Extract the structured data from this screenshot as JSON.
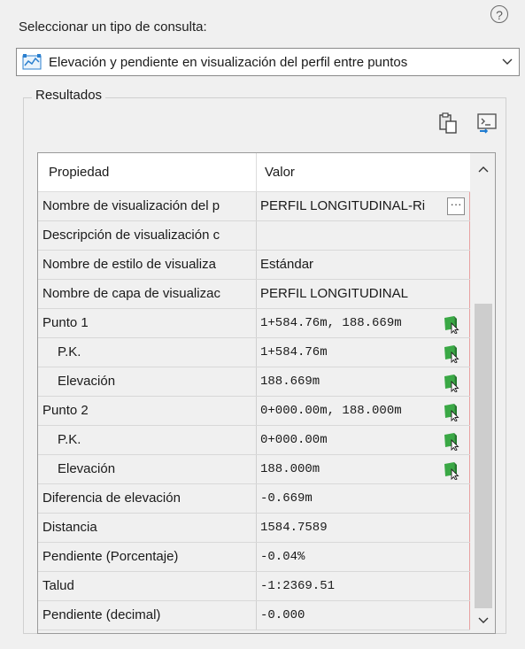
{
  "header": {
    "select_label": "Seleccionar un tipo de consulta:",
    "help_glyph": "?"
  },
  "query_type": {
    "selected": "Elevación y pendiente en visualización del perfil entre puntos",
    "icon": "profile-query-icon"
  },
  "results": {
    "title": "Resultados",
    "tools": [
      "copy-to-clipboard-icon",
      "command-line-icon"
    ],
    "columns": {
      "property": "Propiedad",
      "value": "Valor"
    },
    "rows": [
      {
        "property": "Nombre de visualización del p",
        "value": "PERFIL LONGITUDINAL-Ri",
        "indent": false,
        "control": "ellipsis",
        "ellipsis": "···"
      },
      {
        "property": "Descripción de visualización c",
        "value": "",
        "indent": false,
        "control": "none"
      },
      {
        "property": "Nombre de estilo de visualiza",
        "value": "Estándar",
        "indent": false,
        "control": "none"
      },
      {
        "property": "Nombre de capa de visualizac",
        "value": "PERFIL LONGITUDINAL",
        "indent": false,
        "control": "none"
      },
      {
        "property": "Punto 1",
        "value": "1+584.76m, 188.669m",
        "indent": false,
        "control": "pick"
      },
      {
        "property": "P.K.",
        "value": "1+584.76m",
        "indent": true,
        "control": "pick"
      },
      {
        "property": "Elevación",
        "value": "188.669m",
        "indent": true,
        "control": "pick"
      },
      {
        "property": "Punto 2",
        "value": "0+000.00m, 188.000m",
        "indent": false,
        "control": "pick"
      },
      {
        "property": "P.K.",
        "value": "0+000.00m",
        "indent": true,
        "control": "pick"
      },
      {
        "property": "Elevación",
        "value": "188.000m",
        "indent": true,
        "control": "pick"
      },
      {
        "property": "Diferencia de elevación",
        "value": "-0.669m",
        "indent": false,
        "control": "none"
      },
      {
        "property": "Distancia",
        "value": "1584.7589",
        "indent": false,
        "control": "none"
      },
      {
        "property": "Pendiente (Porcentaje)",
        "value": "-0.04%",
        "indent": false,
        "control": "none"
      },
      {
        "property": "Talud",
        "value": "-1:2369.51",
        "indent": false,
        "control": "none"
      },
      {
        "property": "Pendiente (decimal)",
        "value": "-0.000",
        "indent": false,
        "control": "none"
      }
    ]
  },
  "colors": {
    "pick_green": "#3aa845",
    "accent_blue": "#1e7bd0",
    "red_guide": "#e8a0a0"
  }
}
